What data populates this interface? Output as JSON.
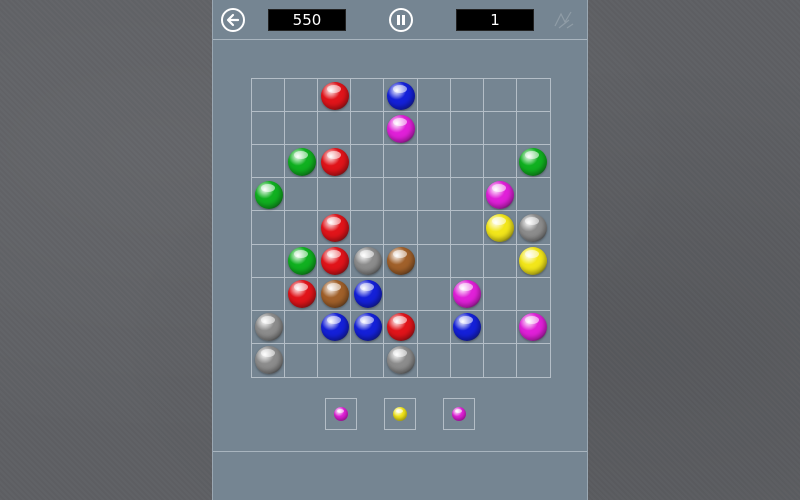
{
  "header": {
    "score": "550",
    "level": "1",
    "back_icon": "arrow-left-icon",
    "pause_icon": "pause-icon",
    "corner_icon": "sketch-figure-icon"
  },
  "board": {
    "rows": 9,
    "cols": 9,
    "balls": [
      {
        "row": 0,
        "col": 2,
        "color": "red"
      },
      {
        "row": 0,
        "col": 4,
        "color": "blue"
      },
      {
        "row": 1,
        "col": 4,
        "color": "magenta"
      },
      {
        "row": 2,
        "col": 1,
        "color": "green"
      },
      {
        "row": 2,
        "col": 2,
        "color": "red"
      },
      {
        "row": 2,
        "col": 8,
        "color": "green"
      },
      {
        "row": 3,
        "col": 0,
        "color": "green"
      },
      {
        "row": 3,
        "col": 7,
        "color": "magenta"
      },
      {
        "row": 4,
        "col": 2,
        "color": "red"
      },
      {
        "row": 4,
        "col": 7,
        "color": "yellow"
      },
      {
        "row": 4,
        "col": 8,
        "color": "gray"
      },
      {
        "row": 5,
        "col": 1,
        "color": "green"
      },
      {
        "row": 5,
        "col": 2,
        "color": "red"
      },
      {
        "row": 5,
        "col": 3,
        "color": "gray"
      },
      {
        "row": 5,
        "col": 4,
        "color": "brown"
      },
      {
        "row": 5,
        "col": 8,
        "color": "yellow"
      },
      {
        "row": 6,
        "col": 1,
        "color": "red"
      },
      {
        "row": 6,
        "col": 2,
        "color": "brown"
      },
      {
        "row": 6,
        "col": 3,
        "color": "blue"
      },
      {
        "row": 6,
        "col": 6,
        "color": "magenta"
      },
      {
        "row": 7,
        "col": 0,
        "color": "gray"
      },
      {
        "row": 7,
        "col": 2,
        "color": "blue"
      },
      {
        "row": 7,
        "col": 3,
        "color": "blue"
      },
      {
        "row": 7,
        "col": 4,
        "color": "red"
      },
      {
        "row": 7,
        "col": 6,
        "color": "blue"
      },
      {
        "row": 7,
        "col": 8,
        "color": "magenta"
      },
      {
        "row": 8,
        "col": 0,
        "color": "gray"
      },
      {
        "row": 8,
        "col": 4,
        "color": "gray"
      }
    ]
  },
  "next_balls": [
    {
      "color": "magenta"
    },
    {
      "color": "yellow"
    },
    {
      "color": "magenta"
    }
  ],
  "colors": {
    "red": "#e0141a",
    "blue": "#1420d8",
    "magenta": "#e020d8",
    "green": "#10b020",
    "yellow": "#f2e61a",
    "gray": "#8c8c8c",
    "brown": "#a0602a",
    "panel": "#758592",
    "background": "#5e6064"
  }
}
